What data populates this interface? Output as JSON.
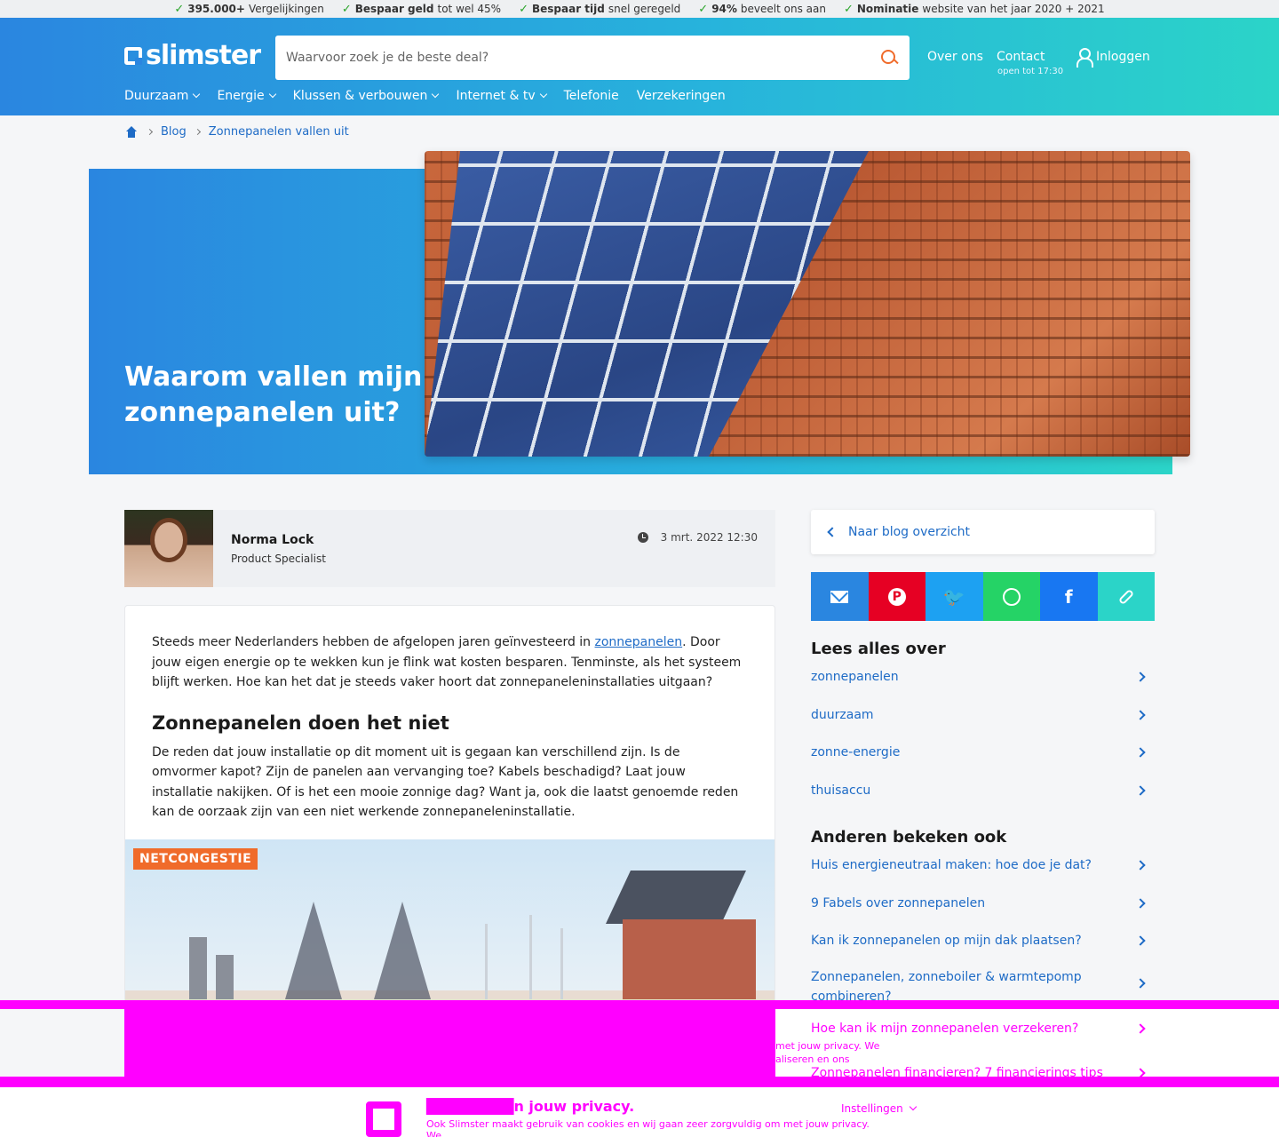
{
  "usp": [
    {
      "bold": "395.000+",
      "rest": " Vergelijkingen"
    },
    {
      "bold": "Bespaar geld",
      "rest": " tot wel 45%"
    },
    {
      "bold": "Bespaar tijd",
      "rest": " snel geregeld"
    },
    {
      "bold": "94%",
      "rest": " beveelt ons aan"
    },
    {
      "bold": "Nominatie",
      "rest": " website van het jaar 2020 + 2021"
    }
  ],
  "header": {
    "logo": "slimster",
    "search_placeholder": "Waarvoor zoek je de beste deal?",
    "over_ons": "Over ons",
    "contact": "Contact",
    "contact_sub": "open tot 17:30",
    "login": "Inloggen",
    "nav": [
      "Duurzaam",
      "Energie",
      "Klussen & verbouwen",
      "Internet & tv",
      "Telefonie",
      "Verzekeringen"
    ]
  },
  "breadcrumb": {
    "blog": "Blog",
    "current": "Zonnepanelen vallen uit"
  },
  "hero": {
    "title": "Waarom vallen mijn zonnepanelen uit?"
  },
  "author": {
    "name": "Norma Lock",
    "role": "Product Specialist",
    "date": "3 mrt. 2022 12:30"
  },
  "article": {
    "p1_before": "Steeds meer Nederlanders hebben de afgelopen jaren geïnvesteerd in ",
    "p1_link": "zonnepanelen",
    "p1_after": ". Door jouw eigen energie op te wekken kun je flink wat kosten besparen. Tenminste, als het systeem blijft werken. Hoe kan het dat je steeds vaker hoort dat zonnepaneleninstallaties uitgaan?",
    "h2": "Zonnepanelen doen het niet",
    "p2": "De reden dat jouw installatie op dit moment uit is gegaan kan verschillend zijn. Is de omvormer kapot? Zijn de panelen aan vervanging toe? Kabels beschadigd? Laat jouw installatie nakijken. Of is het een mooie zonnige dag? Want ja, ook die laatst genoemde reden kan de oorzaak zijn van een niet werkende zonnepaneleninstallatie.",
    "illustration_tag": "NETCONGESTIE"
  },
  "sidebar": {
    "back": "Naar blog overzicht",
    "lees_title": "Lees alles over",
    "lees_items": [
      "zonnepanelen",
      "duurzaam",
      "zonne-energie",
      "thuisaccu"
    ],
    "anderen_title": "Anderen bekeken ook",
    "anderen_items": [
      "Huis energieneutraal maken: hoe doe je dat?",
      "9 Fabels over zonnepanelen",
      "Kan ik zonnepanelen op mijn dak plaatsen?",
      "Zonnepanelen, zonneboiler & warmtepomp combineren?"
    ]
  },
  "cookie": {
    "related_item": "Hoe kan ik mijn zonnepanelen verzekeren?",
    "related_item_2": "Zonnepanelen financieren? 7 financierings tips",
    "title_tail": "n jouw privacy.",
    "text": "Ook Slimster maakt gebruik van cookies en wij gaan zeer zorgvuldig om met jouw privacy. We",
    "text_upper": "met jouw privacy. We",
    "text_upper_2": "aliseren en ons",
    "settings": "Instellingen"
  },
  "colors": {
    "brand_blue": "#2a86e0",
    "brand_teal": "#2bd4c8",
    "accent_orange": "#f06b2a",
    "link_blue": "#1e6bc6"
  }
}
